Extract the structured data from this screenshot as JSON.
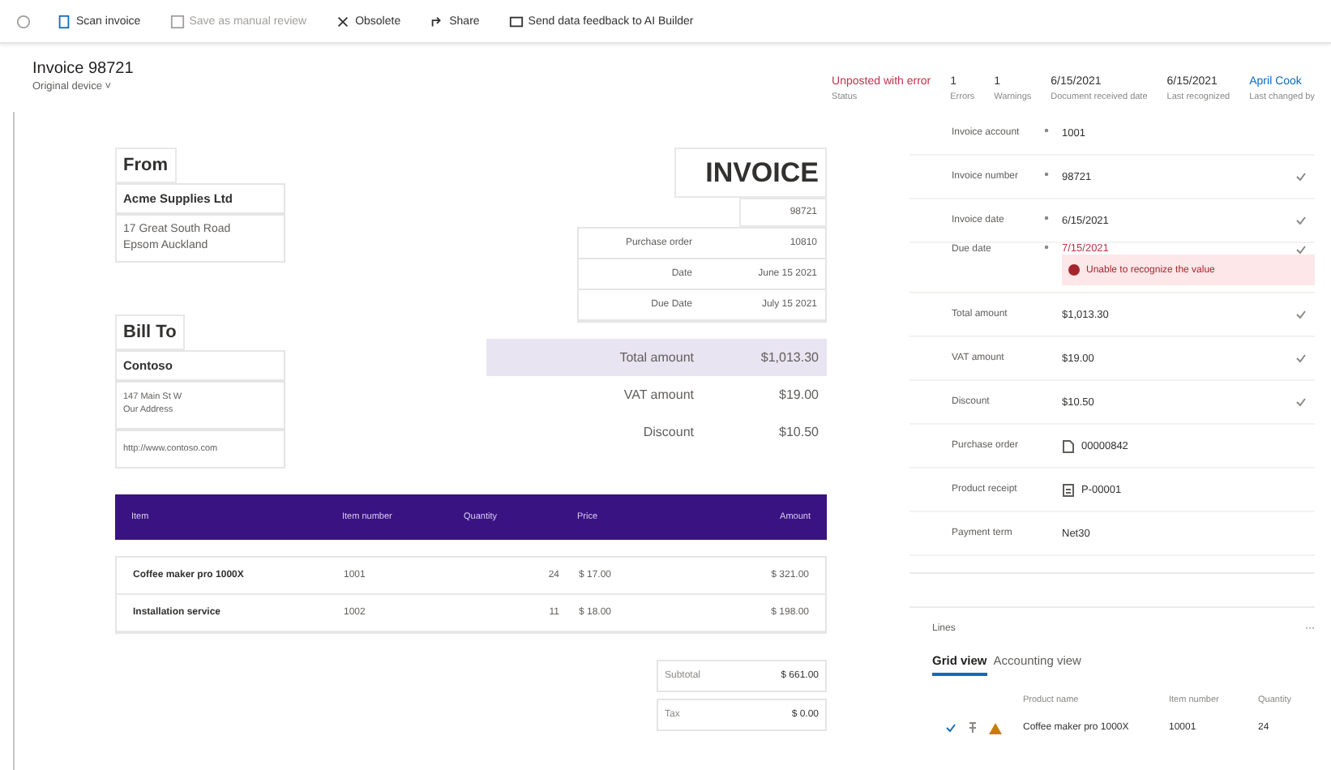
{
  "toolbar": {
    "items": [
      {
        "label": "Scan invoice",
        "disabled": false
      },
      {
        "label": "Save as manual review",
        "disabled": true
      },
      {
        "label": "Obsolete",
        "disabled": false
      },
      {
        "label": "Share",
        "disabled": false
      },
      {
        "label": "Send data feedback to AI Builder",
        "disabled": false
      }
    ]
  },
  "header": {
    "title": "Invoice 98721",
    "subtitle": "Original device ˅"
  },
  "summary": [
    {
      "value": "Unposted with error",
      "label": "Status",
      "kind": "error"
    },
    {
      "value": "1",
      "label": "Errors",
      "kind": "plain"
    },
    {
      "value": "1",
      "label": "Warnings",
      "kind": "plain"
    },
    {
      "value": "6/15/2021",
      "label": "Document received date",
      "kind": "plain"
    },
    {
      "value": "6/15/2021",
      "label": "Last recognized",
      "kind": "plain"
    },
    {
      "value": "April Cook",
      "label": "Last changed by",
      "kind": "link"
    }
  ],
  "document": {
    "from_heading": "From",
    "from_name": "Acme Supplies Ltd",
    "from_address": [
      "17 Great South Road",
      "Epsom Auckland"
    ],
    "bill_heading": "Bill To",
    "bill_name": "Contoso",
    "bill_address": [
      "147 Main St W",
      "Our Address"
    ],
    "bill_url": "http://www.contoso.com",
    "title": "INVOICE",
    "number": "98721",
    "meta": [
      {
        "label": "Purchase order",
        "value": "10810"
      },
      {
        "label": "Date",
        "value": "June 15 2021"
      },
      {
        "label": "Due Date",
        "value": "July 15 2021"
      }
    ],
    "totals": [
      {
        "label": "Total amount",
        "value": "$1,013.30",
        "highlight": true
      },
      {
        "label": "VAT amount",
        "value": "$19.00",
        "highlight": false
      },
      {
        "label": "Discount",
        "value": "$10.50",
        "highlight": false
      }
    ],
    "columns": [
      "Item",
      "Item number",
      "Quantity",
      "Price",
      "Amount"
    ],
    "rows": [
      [
        "Coffee maker pro 1000X",
        "1001",
        "24",
        "$ 17.00",
        "$ 321.00"
      ],
      [
        "Installation service",
        "1002",
        "11",
        "$ 18.00",
        "$ 198.00"
      ]
    ],
    "subtotals": [
      {
        "label": "Subtotal",
        "value": "$ 661.00"
      },
      {
        "label": "Tax",
        "value": "$ 0.00"
      }
    ]
  },
  "fields": [
    {
      "label": "Invoice account",
      "required": true,
      "value": "1001",
      "verified": false,
      "kind": "plain"
    },
    {
      "label": "Invoice number",
      "required": true,
      "value": "98721",
      "verified": true,
      "kind": "plain"
    },
    {
      "label": "Invoice date",
      "required": true,
      "value": "6/15/2021",
      "verified": true,
      "kind": "plain"
    },
    {
      "label": "Due date",
      "required": true,
      "value": "7/15/2021",
      "verified": true,
      "kind": "plain",
      "error": "Unable to recognize the value"
    },
    {
      "label": "Total amount",
      "required": false,
      "value": "$1,013.30",
      "verified": true,
      "kind": "plain"
    },
    {
      "label": "VAT amount",
      "required": false,
      "value": "$19.00",
      "verified": true,
      "kind": "plain"
    },
    {
      "label": "Discount",
      "required": false,
      "value": "$10.50",
      "verified": true,
      "kind": "plain"
    },
    {
      "label": "Purchase order",
      "required": false,
      "value": "00000842",
      "verified": false,
      "kind": "document"
    },
    {
      "label": "Product receipt",
      "required": false,
      "value": "P-00001",
      "verified": false,
      "kind": "receipt"
    },
    {
      "label": "Payment term",
      "required": false,
      "value": "Net30",
      "verified": false,
      "kind": "plain"
    }
  ],
  "lines": {
    "title": "Lines",
    "more": "···",
    "tabs": [
      {
        "label": "Grid view",
        "selected": true
      },
      {
        "label": "Accounting view",
        "selected": false
      }
    ],
    "columns": [
      "Product name",
      "Item number",
      "Quantity"
    ],
    "rows": [
      {
        "cells": [
          "Coffee maker pro 1000X",
          "10001",
          "24"
        ],
        "warning": true
      }
    ]
  }
}
